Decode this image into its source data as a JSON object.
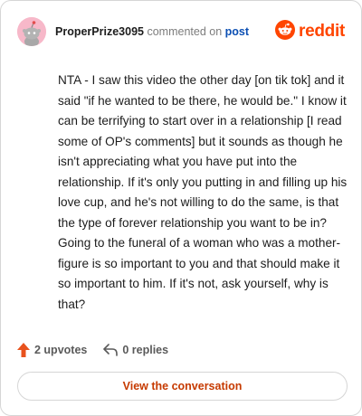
{
  "header": {
    "username": "ProperPrize3095",
    "action_text": "commented on",
    "post_link": "post",
    "logo_text": "reddit"
  },
  "comment": {
    "body": "NTA - I saw this video the other day [on tik tok] and it said \"if he wanted to be there, he would be.\" I know it can be terrifying to start over in a relationship [I read some of OP's comments] but it sounds as though he isn't appreciating what you have put into the relationship. If it's only you putting in and filling up his love cup, and he's not willing to do the same, is that the type of forever relationship you want to be in? Going to the funeral of a woman who was a mother-figure is so important to you and that should make it so important to him. If it's not, ask yourself, why is that?"
  },
  "actions": {
    "upvotes": "2 upvotes",
    "replies": "0 replies"
  },
  "footer": {
    "view_button": "View the conversation"
  },
  "colors": {
    "brand": "#ff4500",
    "link": "#0b4fb3",
    "button_text": "#c63a00",
    "avatar_bg": "#f7b8c9"
  },
  "icons": [
    "snoo-avatar-icon",
    "reddit-logo-icon",
    "upvote-arrow-icon",
    "reply-arrow-icon"
  ]
}
